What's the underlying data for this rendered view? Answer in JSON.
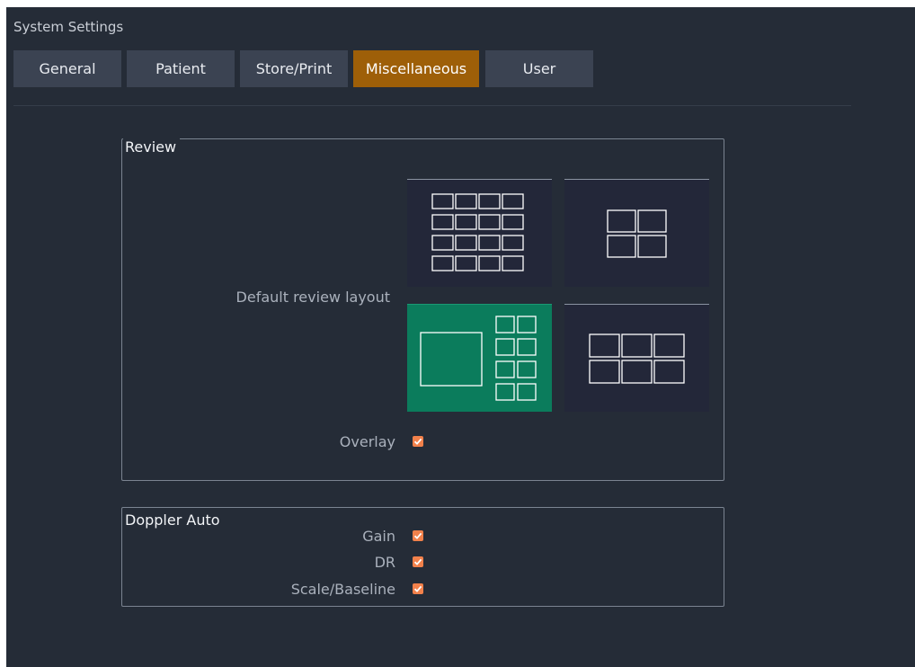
{
  "window": {
    "title": "System Settings"
  },
  "tabs": [
    {
      "label": "General"
    },
    {
      "label": "Patient"
    },
    {
      "label": "Store/Print"
    },
    {
      "label": "Miscellaneous",
      "active": true
    },
    {
      "label": "User"
    }
  ],
  "review": {
    "legend": "Review",
    "default_layout_label": "Default review layout",
    "layouts": [
      {
        "icon": "grid-4x4-layout-icon",
        "selected": false
      },
      {
        "icon": "grid-2x2-layout-icon",
        "selected": false
      },
      {
        "icon": "large-plus-thumbnails-layout-icon",
        "selected": true
      },
      {
        "icon": "grid-3x2-layout-icon",
        "selected": false
      }
    ],
    "overlay": {
      "label": "Overlay",
      "checked": true
    }
  },
  "doppler_auto": {
    "legend": "Doppler Auto",
    "options": [
      {
        "label": "Gain",
        "checked": true
      },
      {
        "label": "DR",
        "checked": true
      },
      {
        "label": "Scale/Baseline",
        "checked": true
      }
    ]
  },
  "colors": {
    "background": "#252c37",
    "active_tab": "#9e5f08",
    "selected_layout": "#0b7c5c",
    "checkbox": "#f2814b"
  }
}
